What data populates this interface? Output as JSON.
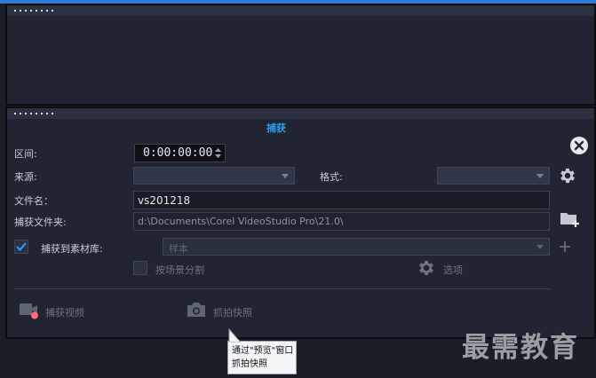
{
  "capture": {
    "title": "捕获",
    "duration_label": "区间:",
    "duration_value": "0:00:00:00",
    "source_label": "来源:",
    "source_value": "",
    "format_label": "格式:",
    "format_value": "",
    "filename_label": "文件名：",
    "filename_value": "vs201218",
    "folder_label": "捕获文件夹:",
    "folder_value": "d:\\Documents\\Corel VideoStudio Pro\\21.0\\",
    "capture_to_library_label": "捕获到素材库:",
    "capture_to_library_checked": true,
    "library_value": "样本",
    "split_by_scene_label": "按场景分割",
    "split_by_scene_checked": false,
    "options_label": "选项",
    "capture_video_label": "捕获视频",
    "snapshot_label": "抓拍快照"
  },
  "tooltip": {
    "line1": "通过\"预览\"窗口",
    "line2": "抓拍快照"
  },
  "watermark": "最需教育",
  "colors": {
    "accent": "#2e9cf0",
    "top_line": "#2e7bd6",
    "panel_bg": "#202531",
    "record_dot": "#ff6b7a"
  }
}
